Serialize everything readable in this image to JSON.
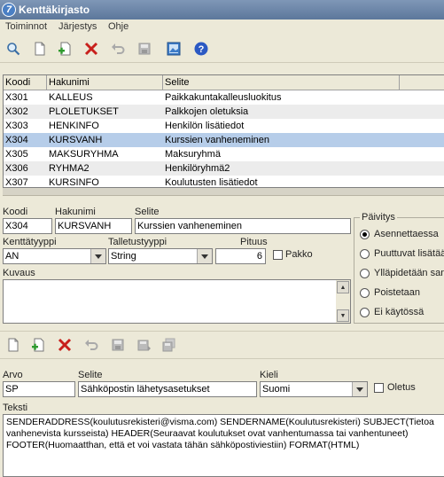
{
  "window": {
    "title": "Kenttäkirjasto"
  },
  "menu": [
    "Toiminnot",
    "Järjestys",
    "Ohje"
  ],
  "grid": {
    "columns": [
      "Koodi",
      "Hakunimi",
      "Selite"
    ],
    "rows": [
      {
        "code": "X301",
        "name": "KALLEUS",
        "desc": "Paikkakuntakalleusluokitus"
      },
      {
        "code": "X302",
        "name": "PLOLETUKSET",
        "desc": "Palkkojen oletuksia"
      },
      {
        "code": "X303",
        "name": "HENKINFO",
        "desc": "Henkilön lisätiedot"
      },
      {
        "code": "X304",
        "name": "KURSVANH",
        "desc": "Kurssien vanheneminen"
      },
      {
        "code": "X305",
        "name": "MAKSURYHMA",
        "desc": "Maksuryhmä"
      },
      {
        "code": "X306",
        "name": "RYHMA2",
        "desc": "Henkilöryhmä2"
      },
      {
        "code": "X307",
        "name": "KURSINFO",
        "desc": "Koulutusten lisätiedot"
      }
    ],
    "selected_index": 3
  },
  "form": {
    "code_label": "Koodi",
    "code_value": "X304",
    "name_label": "Hakunimi",
    "name_value": "KURSVANH",
    "desc_label": "Selite",
    "desc_value": "Kurssien vanheneminen",
    "fieldtype_label": "Kenttätyyppi",
    "fieldtype_value": "AN",
    "storetype_label": "Talletustyyppi",
    "storetype_value": "String",
    "length_label": "Pituus",
    "length_value": "6",
    "required_label": "Pakko",
    "description_label": "Kuvaus"
  },
  "update_group": {
    "title": "Päivitys",
    "options": [
      "Asennettaessa",
      "Puuttuvat lisätää",
      "Ylläpidetään sam",
      "Poistetaan",
      "Ei käytössä"
    ],
    "selected_index": 0
  },
  "value_form": {
    "value_label": "Arvo",
    "value_value": "SP",
    "desc_label": "Selite",
    "desc_value": "Sähköpostin lähetysasetukset",
    "lang_label": "Kieli",
    "lang_value": "Suomi",
    "default_label": "Oletus",
    "text_label": "Teksti",
    "text_value": "SENDERADDRESS(koulutusrekisteri@visma.com) SENDERNAME(Koulutusrekisteri) SUBJECT(Tietoa vanhenevista kursseista) HEADER(Seuraavat koulutukset ovat vanhentumassa tai vanhentuneet) FOOTER(Huomaatthan, että et voi vastata tähän sähköpostiviestiin) FORMAT(HTML)"
  }
}
